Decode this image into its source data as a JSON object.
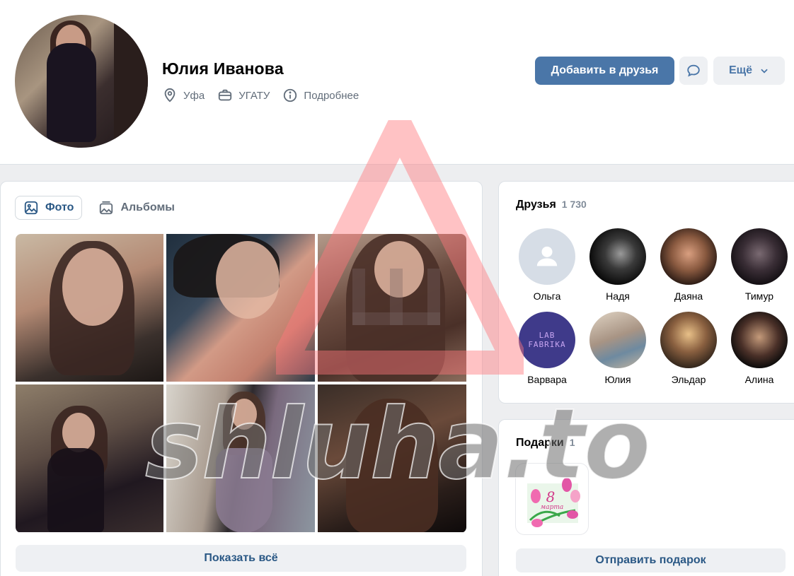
{
  "profile": {
    "name": "Юлия Иванова",
    "city": "Уфа",
    "university": "УГАТУ",
    "more_info": "Подробнее",
    "icons": {
      "city": "location-pin-icon",
      "university": "briefcase-icon",
      "more": "info-icon"
    }
  },
  "actions": {
    "add_friend": "Добавить в друзья",
    "more": "Ещё"
  },
  "photos": {
    "tabs": [
      {
        "label": "Фото",
        "active": true
      },
      {
        "label": "Альбомы",
        "active": false
      }
    ],
    "show_all": "Показать всё",
    "count_visible": 6
  },
  "friends": {
    "title": "Друзья",
    "count": "1 730",
    "items": [
      {
        "name": "Ольга"
      },
      {
        "name": "Надя"
      },
      {
        "name": "Даяна"
      },
      {
        "name": "Тимур"
      },
      {
        "name": "Варвара",
        "avatar_text": "LAB FABRIKA"
      },
      {
        "name": "Юлия"
      },
      {
        "name": "Эльдар"
      },
      {
        "name": "Алина"
      }
    ]
  },
  "gifts": {
    "title": "Подарки",
    "count": "1",
    "gift_text_big": "8",
    "gift_text_small": "марта",
    "send": "Отправить подарок"
  },
  "watermark": {
    "text": "shluha.to"
  },
  "colors": {
    "accent": "#4a76a8",
    "link": "#2a5885",
    "page_bg": "#edeef0",
    "watermark_red": "#ff9ea0"
  }
}
